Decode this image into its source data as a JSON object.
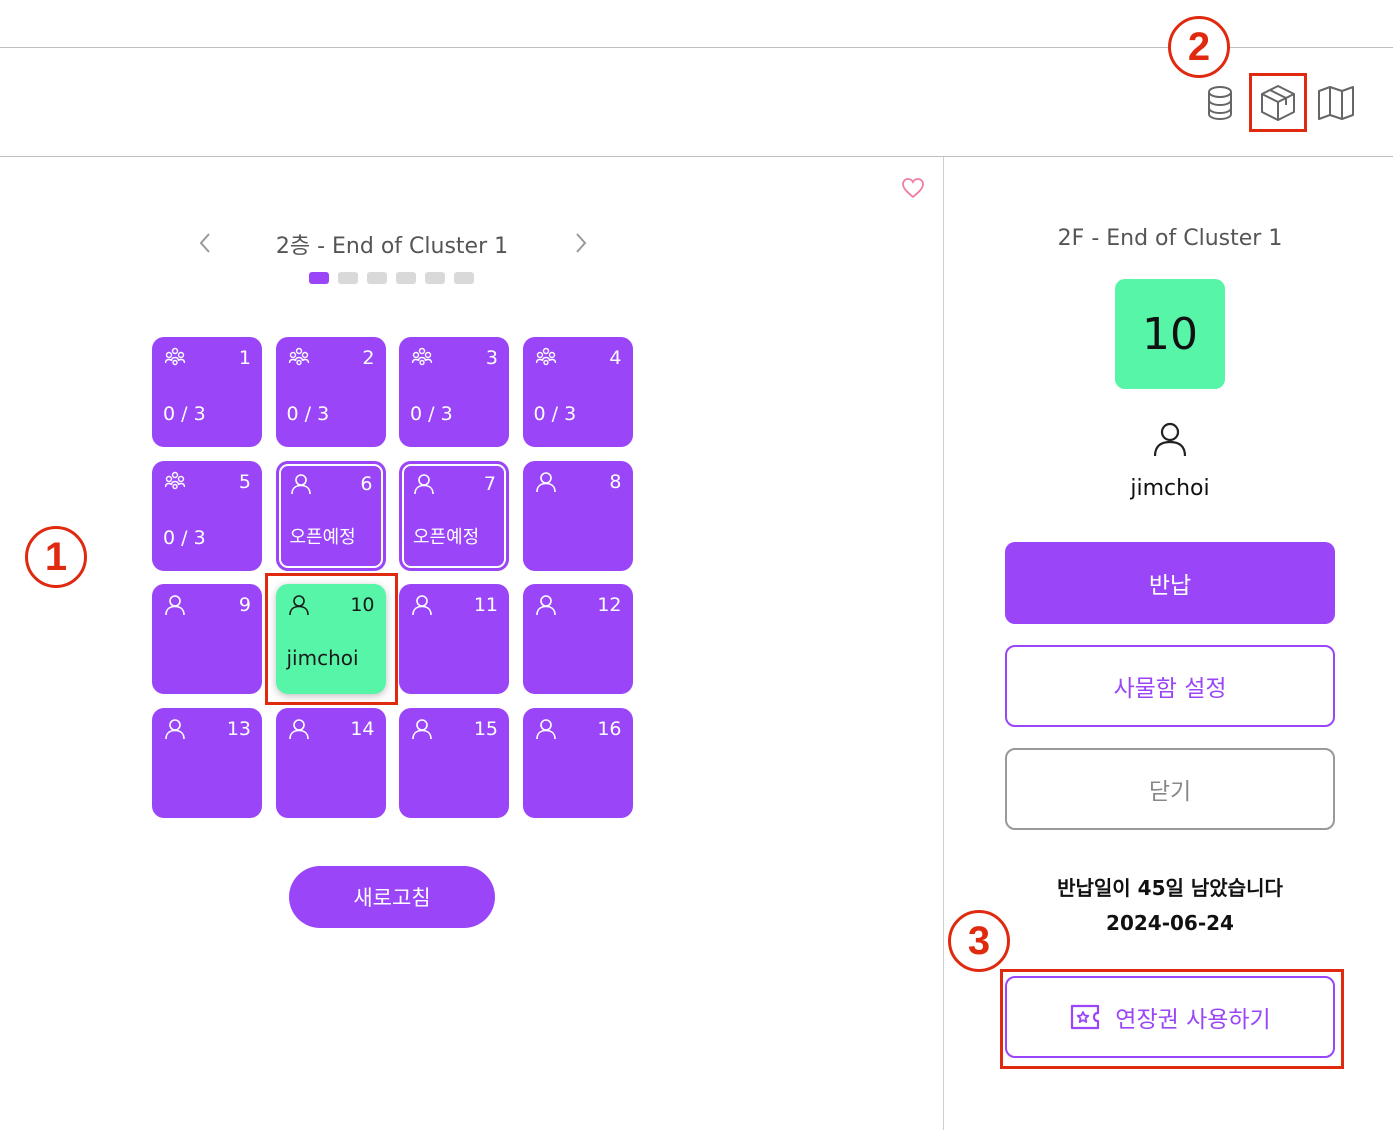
{
  "header": {
    "icons": [
      {
        "name": "database-icon"
      },
      {
        "name": "box-icon"
      },
      {
        "name": "map-icon"
      }
    ]
  },
  "annotations": {
    "marker1": "1",
    "marker2": "2",
    "marker3": "3"
  },
  "locker_map": {
    "floor_title": "2층 - End of Cluster 1",
    "pages": 6,
    "active_page": 1,
    "cells": [
      {
        "num": "1",
        "icon": "group-icon",
        "text": "0 / 3",
        "state": "normal"
      },
      {
        "num": "2",
        "icon": "group-icon",
        "text": "0 / 3",
        "state": "normal"
      },
      {
        "num": "3",
        "icon": "group-icon",
        "text": "0 / 3",
        "state": "normal"
      },
      {
        "num": "4",
        "icon": "group-icon",
        "text": "0 / 3",
        "state": "normal"
      },
      {
        "num": "5",
        "icon": "group-icon",
        "text": "0 / 3",
        "state": "normal"
      },
      {
        "num": "6",
        "icon": "user-icon",
        "text": "오픈예정",
        "state": "outlined"
      },
      {
        "num": "7",
        "icon": "user-icon",
        "text": "오픈예정",
        "state": "outlined"
      },
      {
        "num": "8",
        "icon": "user-icon",
        "text": "",
        "state": "normal"
      },
      {
        "num": "9",
        "icon": "user-icon",
        "text": "",
        "state": "normal"
      },
      {
        "num": "10",
        "icon": "user-icon",
        "text": "jimchoi",
        "state": "selected"
      },
      {
        "num": "11",
        "icon": "user-icon",
        "text": "",
        "state": "normal"
      },
      {
        "num": "12",
        "icon": "user-icon",
        "text": "",
        "state": "normal"
      },
      {
        "num": "13",
        "icon": "user-icon",
        "text": "",
        "state": "normal"
      },
      {
        "num": "14",
        "icon": "user-icon",
        "text": "",
        "state": "normal"
      },
      {
        "num": "15",
        "icon": "user-icon",
        "text": "",
        "state": "normal"
      },
      {
        "num": "16",
        "icon": "user-icon",
        "text": "",
        "state": "normal"
      }
    ],
    "refresh_label": "새로고침"
  },
  "detail_panel": {
    "title": "2F - End of Cluster 1",
    "locker_number": "10",
    "username": "jimchoi",
    "return_label": "반납",
    "settings_label": "사물함 설정",
    "close_label": "닫기",
    "remaining_text": "반납일이 45일 남았습니다",
    "due_date": "2024-06-24",
    "extend_label": "연장권 사용하기"
  },
  "colors": {
    "accent": "#9a45f7",
    "selected": "#56f5a8",
    "annotation_red": "#e02a10"
  }
}
